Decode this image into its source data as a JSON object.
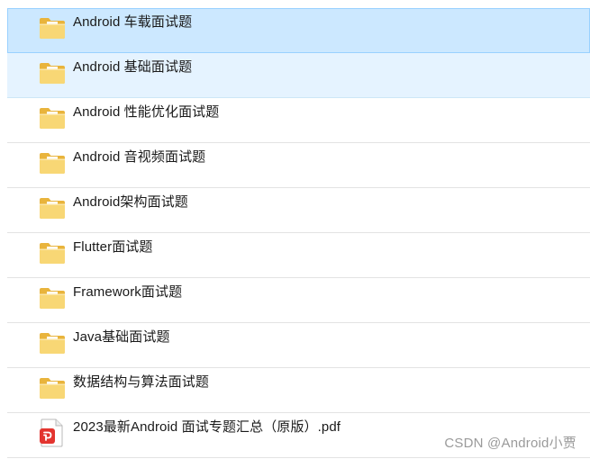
{
  "items": [
    {
      "label": "Android 车载面试题",
      "icon": "folder-icon",
      "type": "folder",
      "state": "selected"
    },
    {
      "label": "Android 基础面试题",
      "icon": "folder-icon",
      "type": "folder",
      "state": "hovered"
    },
    {
      "label": "Android 性能优化面试题",
      "icon": "folder-icon",
      "type": "folder",
      "state": "normal"
    },
    {
      "label": "Android 音视频面试题",
      "icon": "folder-icon",
      "type": "folder",
      "state": "normal"
    },
    {
      "label": "Android架构面试题",
      "icon": "folder-icon",
      "type": "folder",
      "state": "normal"
    },
    {
      "label": "Flutter面试题",
      "icon": "folder-icon",
      "type": "folder",
      "state": "normal"
    },
    {
      "label": "Framework面试题",
      "icon": "folder-icon",
      "type": "folder",
      "state": "normal"
    },
    {
      "label": "Java基础面试题",
      "icon": "folder-icon",
      "type": "folder",
      "state": "normal"
    },
    {
      "label": "数据结构与算法面试题",
      "icon": "folder-icon",
      "type": "folder",
      "state": "normal"
    },
    {
      "label": "2023最新Android 面试专题汇总（原版）.pdf",
      "icon": "pdf-file-icon",
      "type": "pdf",
      "state": "normal"
    }
  ],
  "watermark": "CSDN @Android小贾",
  "colors": {
    "selected_bg": "#cce8ff",
    "hover_bg": "#e5f3ff",
    "folder_yellow": "#f8d775",
    "pdf_red": "#e3342f"
  }
}
